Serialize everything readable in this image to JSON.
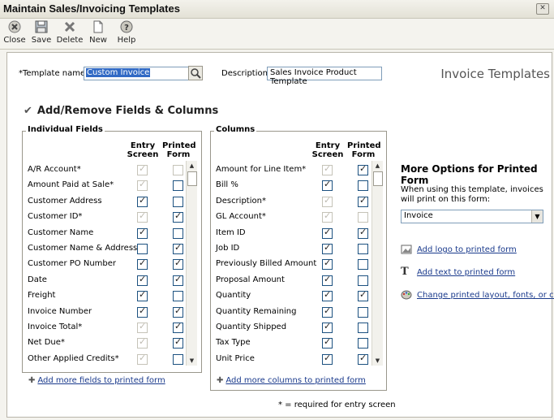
{
  "window": {
    "title": "Maintain Sales/Invoicing Templates"
  },
  "toolbar": {
    "close": "Close",
    "save": "Save",
    "delete": "Delete",
    "new": "New",
    "help": "Help"
  },
  "form": {
    "template_name_label": "*Template name:",
    "template_name_value": "Custom Invoice",
    "description_label": "Description:",
    "description_value": "Sales Invoice Product Template",
    "page_heading": "Invoice Templates",
    "section_heading": "Add/Remove Fields & Columns"
  },
  "individual_fields": {
    "legend": "Individual Fields",
    "col_entry": [
      "Entry",
      "Screen"
    ],
    "col_printed": [
      "Printed",
      "Form"
    ],
    "rows": [
      {
        "name": "A/R Account*",
        "entry": true,
        "entry_disabled": true,
        "printed": false,
        "printed_disabled": true
      },
      {
        "name": "Amount Paid at Sale*",
        "entry": true,
        "entry_disabled": true,
        "printed": false,
        "printed_disabled": false
      },
      {
        "name": "Customer Address",
        "entry": true,
        "entry_disabled": false,
        "printed": false,
        "printed_disabled": false
      },
      {
        "name": "Customer ID*",
        "entry": true,
        "entry_disabled": true,
        "printed": true,
        "printed_disabled": false
      },
      {
        "name": "Customer Name",
        "entry": true,
        "entry_disabled": false,
        "printed": false,
        "printed_disabled": false
      },
      {
        "name": "Customer Name & Address",
        "entry": false,
        "entry_disabled": false,
        "printed": true,
        "printed_disabled": false
      },
      {
        "name": "Customer PO Number",
        "entry": true,
        "entry_disabled": false,
        "printed": true,
        "printed_disabled": false
      },
      {
        "name": "Date",
        "entry": true,
        "entry_disabled": false,
        "printed": true,
        "printed_disabled": false
      },
      {
        "name": "Freight",
        "entry": true,
        "entry_disabled": false,
        "printed": false,
        "printed_disabled": false
      },
      {
        "name": "Invoice Number",
        "entry": true,
        "entry_disabled": false,
        "printed": true,
        "printed_disabled": false
      },
      {
        "name": "Invoice Total*",
        "entry": true,
        "entry_disabled": true,
        "printed": true,
        "printed_disabled": false
      },
      {
        "name": "Net Due*",
        "entry": true,
        "entry_disabled": true,
        "printed": true,
        "printed_disabled": false
      },
      {
        "name": "Other Applied Credits*",
        "entry": true,
        "entry_disabled": true,
        "printed": false,
        "printed_disabled": false
      }
    ],
    "add_link": "Add more fields to printed form"
  },
  "columns": {
    "legend": "Columns",
    "col_entry": [
      "Entry",
      "Screen"
    ],
    "col_printed": [
      "Printed",
      "Form"
    ],
    "rows": [
      {
        "name": "Amount for Line Item*",
        "entry": true,
        "entry_disabled": true,
        "printed": true,
        "printed_disabled": false
      },
      {
        "name": "Bill %",
        "entry": true,
        "entry_disabled": false,
        "printed": false,
        "printed_disabled": false
      },
      {
        "name": "Description*",
        "entry": true,
        "entry_disabled": true,
        "printed": true,
        "printed_disabled": false
      },
      {
        "name": "GL Account*",
        "entry": true,
        "entry_disabled": true,
        "printed": false,
        "printed_disabled": true
      },
      {
        "name": "Item ID",
        "entry": true,
        "entry_disabled": false,
        "printed": true,
        "printed_disabled": false
      },
      {
        "name": "Job ID",
        "entry": true,
        "entry_disabled": false,
        "printed": false,
        "printed_disabled": false
      },
      {
        "name": "Previously Billed Amount",
        "entry": true,
        "entry_disabled": false,
        "printed": false,
        "printed_disabled": false
      },
      {
        "name": "Proposal Amount",
        "entry": true,
        "entry_disabled": false,
        "printed": false,
        "printed_disabled": false
      },
      {
        "name": "Quantity",
        "entry": true,
        "entry_disabled": false,
        "printed": true,
        "printed_disabled": false
      },
      {
        "name": "Quantity Remaining",
        "entry": true,
        "entry_disabled": false,
        "printed": false,
        "printed_disabled": false
      },
      {
        "name": "Quantity Shipped",
        "entry": true,
        "entry_disabled": false,
        "printed": false,
        "printed_disabled": false
      },
      {
        "name": "Tax Type",
        "entry": true,
        "entry_disabled": false,
        "printed": false,
        "printed_disabled": false
      },
      {
        "name": "Unit Price",
        "entry": true,
        "entry_disabled": false,
        "printed": true,
        "printed_disabled": false
      }
    ],
    "add_link": "Add more columns to printed form"
  },
  "required_note": "* = required for entry screen",
  "more_options": {
    "title": "More Options for Printed Form",
    "description": "When using this template, invoices will print on this form:",
    "form_select": "Invoice",
    "add_logo": "Add logo to printed form",
    "add_text": "Add text to printed form",
    "change_layout": "Change printed layout, fonts, or color"
  }
}
